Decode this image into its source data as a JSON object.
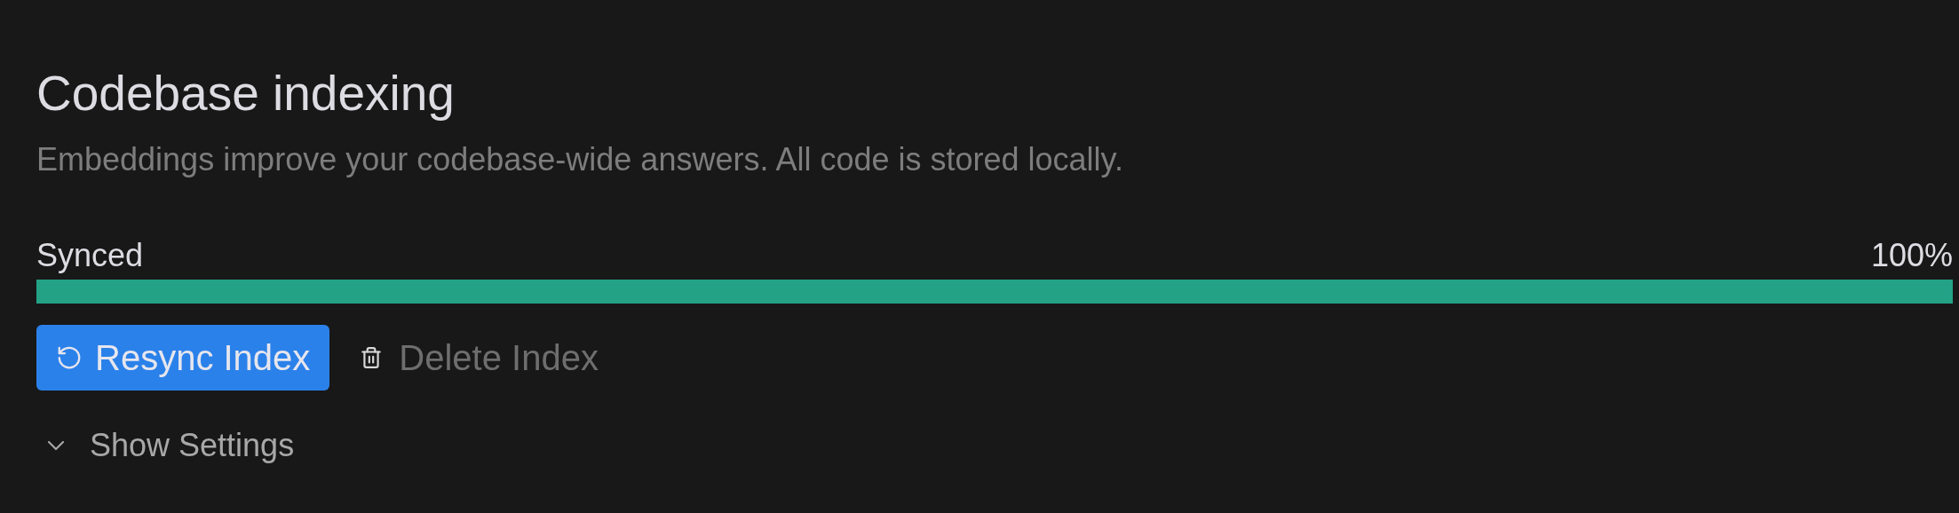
{
  "title": "Codebase indexing",
  "description": "Embeddings improve your codebase-wide answers. All code is stored locally.",
  "progress": {
    "label": "Synced",
    "reading": "100%",
    "level": 1
  },
  "buttons": [
    {
      "kind": "primary",
      "label": "Resync Index",
      "disabled": false
    },
    {
      "kind": "danger",
      "label": "Delete Index",
      "disabled": true
    }
  ],
  "settings_toggle": {
    "label": "Show Settings",
    "expanded": false
  }
}
